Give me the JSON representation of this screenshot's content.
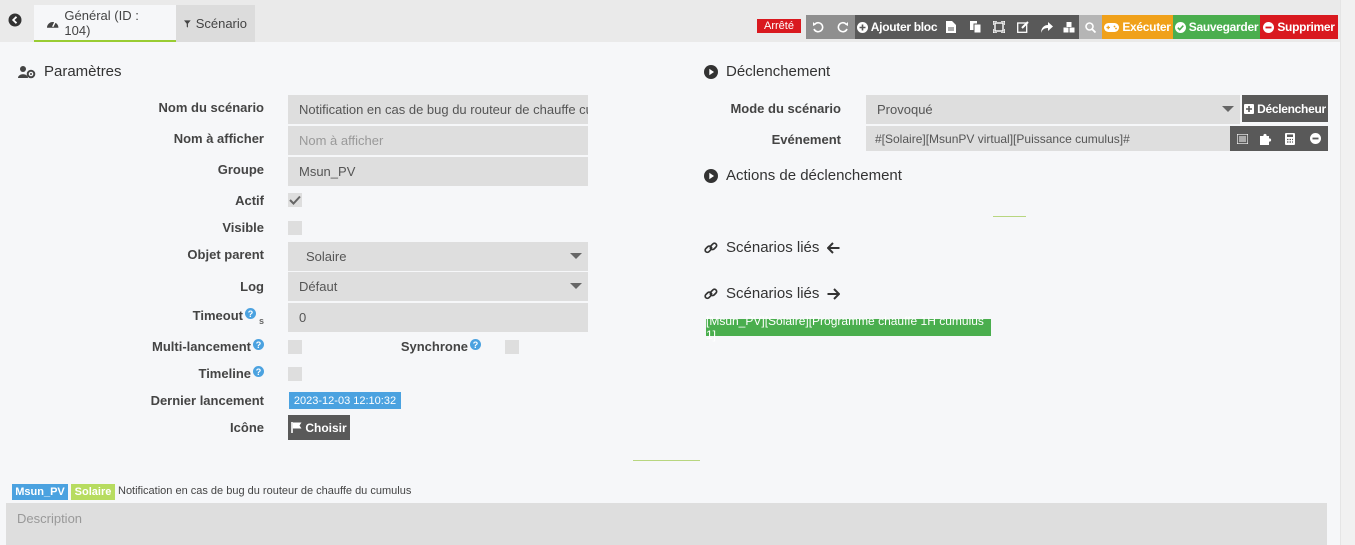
{
  "tabs": {
    "general_label": "Général (ID : 104)",
    "scenario_label": "Scénario"
  },
  "toolbar": {
    "status": "Arrêté",
    "add_block_label": "Ajouter bloc",
    "execute_label": "Exécuter",
    "save_label": "Sauvegarder",
    "delete_label": "Supprimer"
  },
  "parameters": {
    "title": "Paramètres",
    "name_label": "Nom du scénario",
    "name_value": "Notification en cas de bug du routeur de chauffe cumulus",
    "display_name_label": "Nom à afficher",
    "display_name_placeholder": "Nom à afficher",
    "group_label": "Groupe",
    "group_value": "Msun_PV",
    "active_label": "Actif",
    "active_checked": true,
    "visible_label": "Visible",
    "visible_checked": false,
    "parent_label": "Objet parent",
    "parent_value": "Solaire",
    "log_label": "Log",
    "log_value": "Défaut",
    "timeout_label": "Timeout",
    "timeout_unit": "s",
    "timeout_value": "0",
    "multi_label": "Multi-lancement",
    "multi_checked": false,
    "sync_label": "Synchrone",
    "sync_checked": false,
    "timeline_label": "Timeline",
    "timeline_checked": false,
    "last_run_label": "Dernier lancement",
    "last_run_value": "2023-12-03 12:10:32",
    "icon_label": "Icône",
    "choose_label": "Choisir"
  },
  "trigger": {
    "title": "Déclenchement",
    "mode_label": "Mode du scénario",
    "mode_value": "Provoqué",
    "add_trigger_label": "Déclencheur",
    "event_label": "Evénement",
    "event_value": "#[Solaire][MsunPV virtual][Puissance cumulus]#",
    "actions_title": "Actions de déclenchement",
    "linked_in_title": "Scénarios liés",
    "linked_out_title": "Scénarios liés",
    "linked_scenario": "[Msun_PV][Solaire][Programme chauffe 1H cumulus 1]"
  },
  "footer": {
    "tag_group": "Msun_PV",
    "tag_object": "Solaire",
    "name": "Notification en cas de bug du routeur de chauffe du cumulus",
    "description_placeholder": "Description"
  }
}
